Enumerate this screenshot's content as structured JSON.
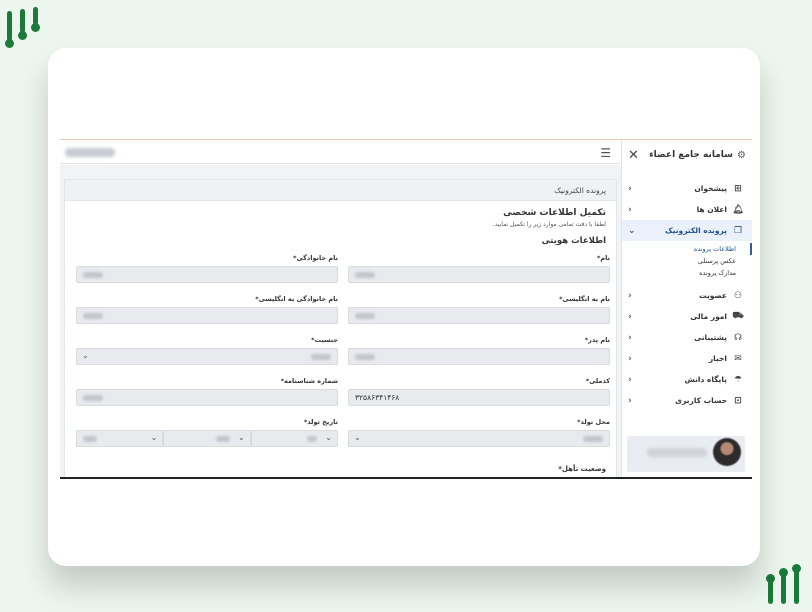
{
  "brand": {
    "accent": "#1b7a3a"
  },
  "sidebar": {
    "title": "سامانه جامع اعضاء",
    "title_icon": "gear-icon",
    "close_icon": "close-icon",
    "items": [
      {
        "label": "پیشخوان",
        "icon": "grid-icon"
      },
      {
        "label": "اعلان ها",
        "icon": "bell-icon"
      },
      {
        "label": "پرونده الکترونیک",
        "icon": "folder-icon",
        "active": true,
        "sub": [
          {
            "label": "اطلاعات پرونده",
            "active": true
          },
          {
            "label": "عکس پرسنلی"
          },
          {
            "label": "مدارک پرونده"
          }
        ]
      },
      {
        "label": "عضویت",
        "icon": "user-add-icon"
      },
      {
        "label": "امور مالی",
        "icon": "cart-icon"
      },
      {
        "label": "پشتیبانی",
        "icon": "headset-icon"
      },
      {
        "label": "اخبار",
        "icon": "chat-icon"
      },
      {
        "label": "پایگاه دانش",
        "icon": "umbrella-icon"
      },
      {
        "label": "حساب کاربری",
        "icon": "account-icon"
      }
    ]
  },
  "topbar": {
    "menu_icon": "hamburger-icon"
  },
  "panel": {
    "header": "پرونده الکترونیک",
    "title": "تکمیل اطلاعات شخصی",
    "description": "لطفا با دقت تمامی موارد زیر را تکمیل نمایید.",
    "section": "اطلاعات هویتی"
  },
  "form": {
    "first_name_label": "نام*",
    "last_name_label": "نام خانوادگی*",
    "first_name_en_label": "نام به انگلیسی*",
    "last_name_en_label": "نام خانوادگی به انگلیسی*",
    "father_name_label": "نام پدر*",
    "gender_label": "جنسیت*",
    "national_code_label": "کدملی*",
    "national_code_value": "۳۲۵۸۶۳۴۱۴۶۸",
    "id_number_label": "شماره شناسنامه*",
    "birth_place_label": "محل تولد*",
    "birth_date_label": "تاریخ تولد*",
    "marital_label": "وضعیت تأهل*"
  }
}
